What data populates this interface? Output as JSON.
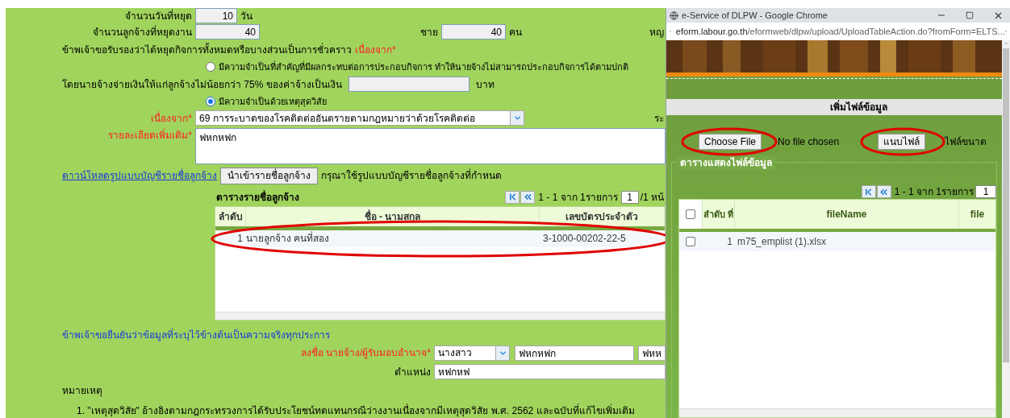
{
  "main": {
    "rest_days": {
      "label": "จำนวนวันที่หยุด",
      "value": "10",
      "unit": "วัน"
    },
    "stopped_employees": {
      "label": "จำนวนลูกจ้างที่หยุดงาน",
      "value": "40",
      "male_label": "ชาย",
      "male_value": "40",
      "unit": "คน",
      "female_label": "หญ"
    },
    "certify": {
      "text": "ข้าพเจ้าขอรับรองว่าได้หยุดกิจการทั้งหมดหรือบางส่วนเป็นการชั่วคราว",
      "required_label": "เนื่องจาก*"
    },
    "reasons": [
      {
        "label": "มีความจำเป็นที่สำคัญที่มีผลกระทบต่อการประกอบกิจการ ทำให้นายจ้างไม่สามารถประกอบกิจการได้ตามปกติ",
        "selected": false,
        "payment": {
          "text": "โดยนายจ้างจ่ายเงินให้แก่ลูกจ้างไม่น้อยกว่า 75% ของค่าจ้างเป็นเงิน",
          "unit": "บาท"
        }
      },
      {
        "label": "มีความจำเป็นด้วยเหตุสุดวิสัย",
        "selected": true
      }
    ],
    "cause": {
      "label": "เนื่องจาก*",
      "value": "69 การระบาดของโรคติดต่ออันตรายตามกฎหมายว่าด้วยโรคติดต่อ",
      "side_label": "ระ"
    },
    "details": {
      "label": "รายละเอียดเพิ่มเติม*",
      "value": "ฟหกหฟก"
    },
    "import": {
      "link": "ดาวน์โหลดรูปแบบบัญชีรายชื่อลูกจ้าง",
      "button": "นำเข้ารายชื่อลูกจ้าง",
      "hint": "กรุณาใช้รูปแบบบัญชีรายชื่อลูกจ้างที่กำหนด"
    },
    "employee_table": {
      "title": "ตารางรายชื่อลูกจ้าง",
      "pager": {
        "range": "1 - 1 จาก 1รายการ",
        "page": "1",
        "pages": "/1 หน้"
      },
      "columns": [
        "ลำดับ",
        "ชื่อ - นามสกุล",
        "เลขบัตรประจำตัว"
      ],
      "rows": [
        {
          "cells": [
            "1",
            "นายลูกจ้าง คนที่สอง",
            "3-1000-00202-22-5"
          ]
        }
      ]
    },
    "confirm": "ข้าพเจ้าขอยืนยันว่าข้อมูลที่ระบุไว้ข้างต้นเป็นความจริงทุกประการ",
    "signature": {
      "label": "ลงชื่อ นายจ้าง/ผู้รับมอบอำนาจ*",
      "title": "นางสาว",
      "first_name": "ฟหกหฟก",
      "last_name": "ฟหห"
    },
    "position": {
      "label": "ตำแหน่ง",
      "value": "หฟกหฟ"
    },
    "notes": {
      "title": "หมายเหตุ",
      "items": [
        "1. \"เหตุสุดวิสัย\" อ้างอิงตามกฎกระทรวงการได้รับประโยชน์ทดแทนกรณีว่างงานเนื่องจากมีเหตุสุดวิสัย พ.ศ. 2562 และฉบับที่แก้ไขเพิ่มเติม"
      ]
    }
  },
  "popup": {
    "title": "e-Service of DLPW - Google Chrome",
    "url_host": "eform.labour.go.th",
    "url_path": "/eformweb/dlpw/upload/UploadTableAction.do?fromForm=ELTS...",
    "heading": "เพิ่มไฟล์ข้อมูล",
    "file_button": "Choose File",
    "file_status": "No file chosen",
    "attach_button": "แนบไฟล์",
    "size_note": "ไฟล์ขนาด",
    "fieldset": "ตารางแสดงไฟล์ข้อมูล",
    "pager": {
      "range": "1 - 1 จาก 1รายการ",
      "page": "1"
    },
    "header_checked": false,
    "columns": [
      "ลำดับ ที่",
      "fileName",
      "file"
    ],
    "rows": [
      {
        "checked": false,
        "cells": [
          "1",
          "m75_emplist (1).xlsx"
        ]
      }
    ]
  }
}
